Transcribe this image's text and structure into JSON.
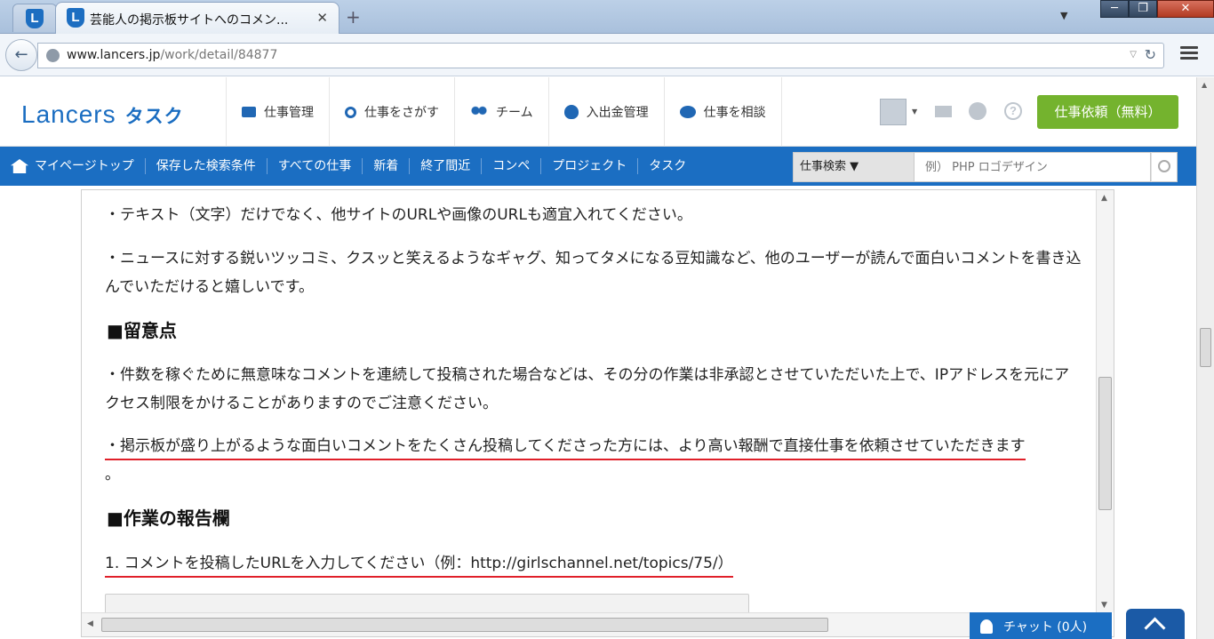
{
  "browser": {
    "tab_title": "芸能人の掲示板サイトへのコメン...",
    "tab_close": "✕",
    "new_tab": "+",
    "url_host": "www.lancers.jp",
    "url_path": "/work/detail/84877"
  },
  "header": {
    "logo_main": "Lancers",
    "logo_sub": "タスク",
    "nav": [
      "仕事管理",
      "仕事をさがす",
      "チーム",
      "入出金管理",
      "仕事を相談"
    ],
    "request_button": "仕事依頼（無料）"
  },
  "subnav": {
    "items": [
      "マイページトップ",
      "保存した検索条件",
      "すべての仕事",
      "新着",
      "終了間近",
      "コンペ",
      "プロジェクト",
      "タスク"
    ],
    "search_category": "仕事検索 ▼",
    "search_placeholder": "例） PHP ロゴデザイン"
  },
  "content": {
    "p1": "・テキスト（文字）だけでなく、他サイトのURLや画像のURLも適宜入れてください。",
    "p2": "・ニュースに対する鋭いツッコミ、クスッと笑えるようなギャグ、知ってタメになる豆知識など、他のユーザーが読んで面白いコメントを書き込んでいただけると嬉しいです。",
    "h1": "■留意点",
    "p3": "・件数を稼ぐために無意味なコメントを連続して投稿された場合などは、その分の作業は非承認とさせていただいた上で、IPアドレスを元にアクセス制限をかけることがありますのでご注意ください。",
    "p4": "・掲示板が盛り上がるような面白いコメントをたくさん投稿してくださった方には、より高い報酬で直接仕事を依頼させていただきます",
    "p4_tail": "。",
    "h2": "■作業の報告欄",
    "q1": "1. コメントを投稿したURLを入力してください（例：http://girlschannel.net/topics/75/）"
  },
  "chat": {
    "label": "チャット (0人)"
  }
}
